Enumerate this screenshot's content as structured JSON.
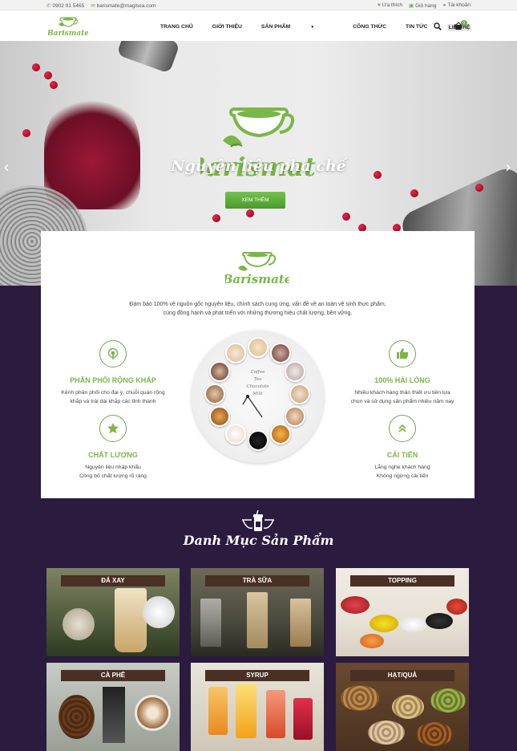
{
  "topbar": {
    "phone": "0902 91 5465",
    "email": "barismate@magisea.com",
    "wishlist": "Ưa thích",
    "cart": "Giỏ hàng",
    "account": "Tài khoản"
  },
  "nav": {
    "logo_text": "Barismate",
    "items": [
      "TRANG CHỦ",
      "GIỚI THIỆU",
      "SẢN PHẨM",
      "CÔNG THỨC",
      "TIN TỨC",
      "LIÊN HỆ"
    ],
    "cart_count": "0"
  },
  "hero": {
    "logo_text": "Barismate",
    "title": "Nguyên liệu pha chế",
    "button": "XEM THÊM",
    "prev_icon": "chevron-left-icon",
    "next_icon": "chevron-right-icon"
  },
  "about": {
    "logo_text": "Barismate",
    "intro_line1": "Đảm bảo 100% về nguồn gốc nguyên liệu, chính sách cung ứng, vấn đề về an toàn vệ sinh thực phẩm,",
    "intro_line2": "cùng đồng hành và phát triển với những thương hiệu chất lượng, bền vững.",
    "features": [
      {
        "icon": "broadcast-icon",
        "title": "PHÂN PHỐI RỘNG KHẮP",
        "line1": "Kênh phân phối cho đại ý, chuỗi quán rộng",
        "line2": "khắp và trải dài khắp các tỉnh thành"
      },
      {
        "icon": "star-icon",
        "title": "CHẤT LƯỢNG",
        "line1": "Nguyên liệu nhập khẩu",
        "line2": "Công bố chất lượng rõ ràng"
      },
      {
        "icon": "thumbs-up-icon",
        "title": "100% HÀI LÒNG",
        "line1": "Nhiều khách hàng thân thiết ưu tiên lựa",
        "line2": "chọn và sử dụng sản phẩm nhiều năm nay"
      },
      {
        "icon": "chevrons-up-icon",
        "title": "CẢI TIẾN",
        "line1": "Lắng nghe khách hàng",
        "line2": "Không ngừng cải tiến"
      }
    ],
    "clock_text": [
      "Coffee",
      "Tea",
      "Chocolate",
      "Milk"
    ]
  },
  "categories": {
    "title": "Danh Mục Sản Phẩm",
    "items": [
      "ĐÁ XAY",
      "TRÀ SỮA",
      "TOPPING",
      "CÀ PHÊ",
      "SYRUP",
      "HẠT/QUẢ"
    ]
  },
  "colors": {
    "accent": "#7ab648",
    "dark_bg": "#2b1b3f",
    "label_bg": "#4a2f24"
  }
}
